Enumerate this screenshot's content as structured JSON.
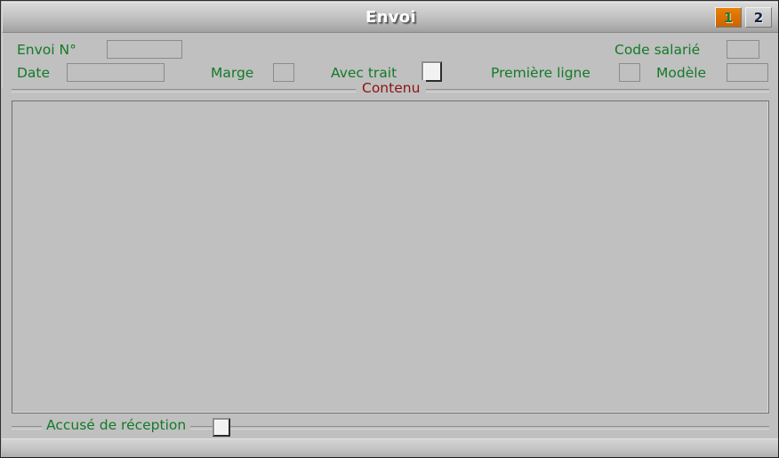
{
  "window": {
    "title": "Envoi",
    "bg_color": "#c0c0c0",
    "label_color": "#127a27",
    "legend_color": "#8d1212",
    "accent_color": "#d96f00"
  },
  "tabs": [
    {
      "label": "1",
      "active": true
    },
    {
      "label": "2",
      "active": false
    }
  ],
  "form": {
    "envoi_num": {
      "label": "Envoi N°",
      "value": ""
    },
    "date": {
      "label": "Date",
      "value": ""
    },
    "marge": {
      "label": "Marge",
      "value": ""
    },
    "avec_trait": {
      "label": "Avec trait",
      "checked": false
    },
    "premiere_ligne": {
      "label": "Première ligne",
      "value": ""
    },
    "code_salarie": {
      "label": "Code salarié",
      "value": ""
    },
    "modele": {
      "label": "Modèle",
      "value": ""
    }
  },
  "content_group": {
    "legend": "Contenu",
    "text": ""
  },
  "bottom": {
    "accuse_reception": {
      "label": "Accusé de réception",
      "checked": false
    }
  }
}
